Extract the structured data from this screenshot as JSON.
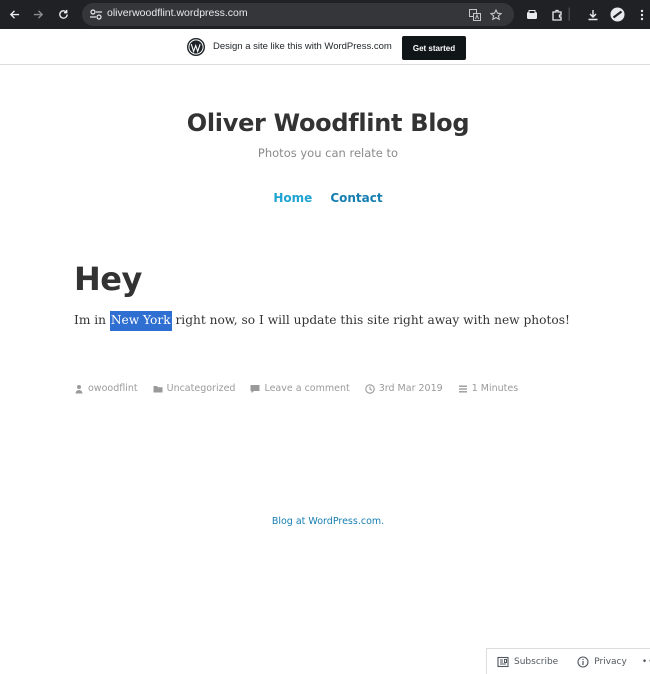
{
  "browser": {
    "url": "oliverwoodflint.wordpress.com"
  },
  "wp_banner": {
    "text": "Design a site like this with WordPress.com",
    "button": "Get started"
  },
  "site": {
    "title": "Oliver Woodflint Blog",
    "tagline": "Photos you can relate to",
    "menu": [
      {
        "label": "Home"
      },
      {
        "label": "Contact"
      }
    ]
  },
  "post": {
    "title": "Hey",
    "body_before": "Im in ",
    "body_highlight": "New York",
    "body_after": " right now, so I will update this site right away with new photos!",
    "meta": {
      "author": "owoodflint",
      "category": "Uncategorized",
      "comment": "Leave a comment",
      "date": "3rd Mar 2019",
      "read_time": "1 Minutes"
    }
  },
  "footer": {
    "link": "Blog at WordPress.com."
  },
  "action_bar": {
    "subscribe": "Subscribe",
    "privacy": "Privacy",
    "more": "•••"
  }
}
